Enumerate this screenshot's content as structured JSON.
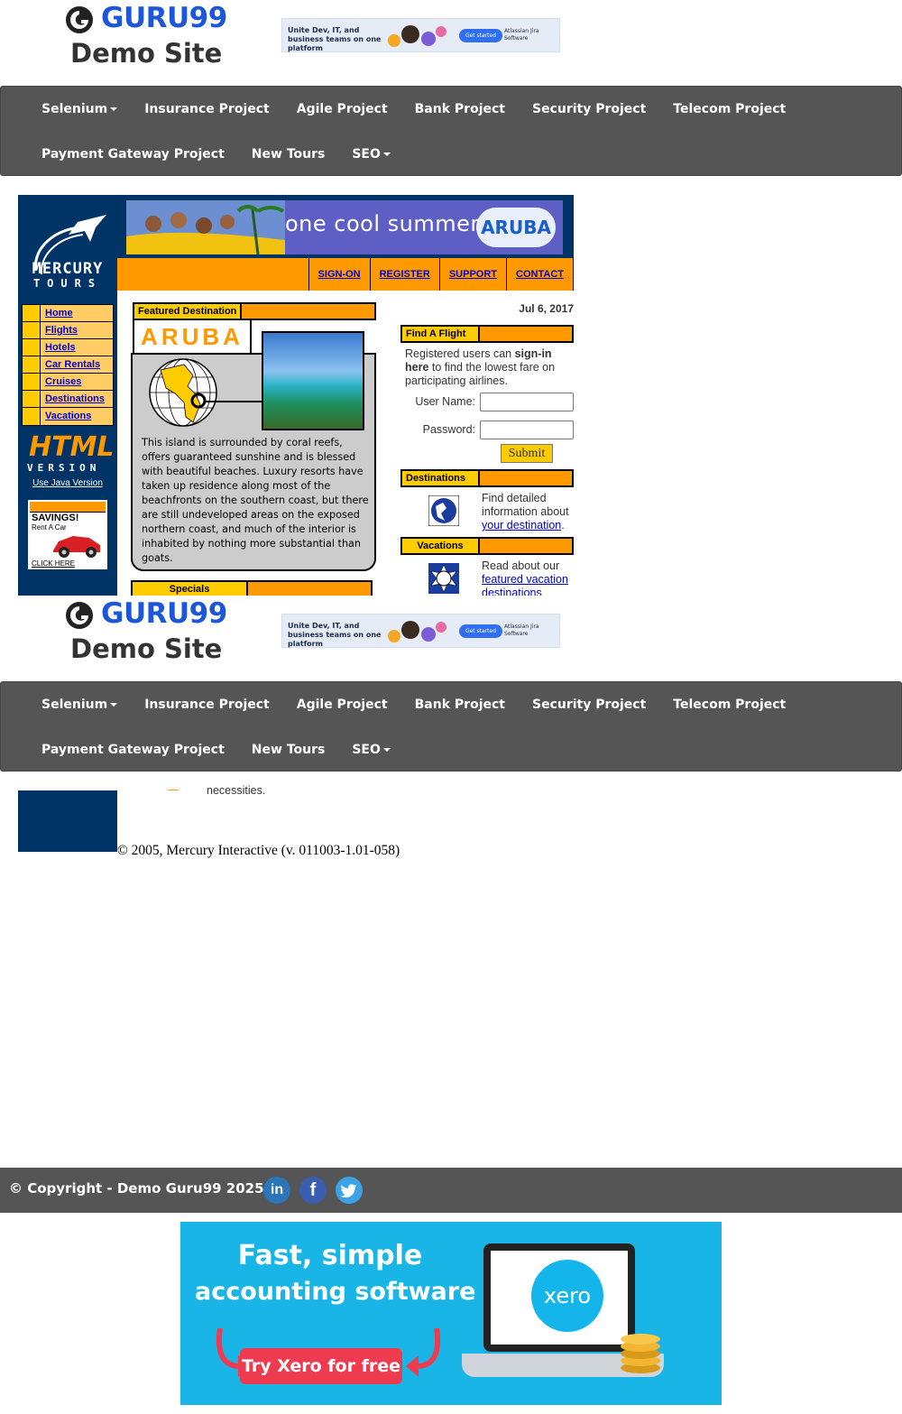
{
  "header": {
    "logo_brand": "GURU99",
    "logo_sub": "Demo Site",
    "ad_text": "Unite Dev, IT, and business teams on one platform",
    "ad_button": "Get started",
    "ad_brand": "Atlassian Jira Software"
  },
  "nav": {
    "row1": [
      {
        "label": "Selenium",
        "caret": true
      },
      {
        "label": "Insurance Project",
        "caret": false
      },
      {
        "label": "Agile Project",
        "caret": false
      },
      {
        "label": "Bank Project",
        "caret": false
      },
      {
        "label": "Security Project",
        "caret": false
      },
      {
        "label": "Telecom Project",
        "caret": false
      }
    ],
    "row2": [
      {
        "label": "Payment Gateway Project",
        "caret": false
      },
      {
        "label": "New Tours",
        "caret": false
      },
      {
        "label": "SEO",
        "caret": true
      }
    ]
  },
  "mercury": {
    "logo_line1": "MERCURY",
    "logo_line2": "TOURS",
    "banner_text": "one cool summer",
    "banner_badge": "ARUBA",
    "top_links": [
      "SIGN-ON",
      "REGISTER",
      "SUPPORT",
      "CONTACT"
    ],
    "menu": [
      "Home",
      "Flights",
      "Hotels",
      "Car Rentals",
      "Cruises",
      "Destinations",
      "Vacations"
    ],
    "html_word": "HTML",
    "html_version": "VERSION",
    "java_link": "Use Java Version",
    "savings_title": "SAVINGS!",
    "savings_sub": "Rent A Car",
    "savings_click": "CLICK HERE",
    "featured_label": "Featured Destination",
    "featured_title": "ARUBA",
    "featured_text": "This island is surrounded by coral reefs, offers guaranteed sunshine and is blessed with beautiful beaches. Luxury resorts have taken up residence along most of the beachfronts on the southern coast, but there are still undeveloped areas on the exposed northern coast, and much of the interior is inhabited by nothing more substantial than goats.",
    "specials_label": "Specials",
    "date": "Jul 6, 2017",
    "find_flight_label": "Find A Flight",
    "signin_pre": "Registered users can ",
    "signin_bold": "sign-in here",
    "signin_post": " to find the lowest fare on participating airlines.",
    "username_label": "User Name:",
    "password_label": "Password:",
    "username_value": "",
    "password_value": "",
    "submit_label": "Submit",
    "destinations_label": "Destinations",
    "destinations_pre": "Find detailed information about ",
    "destinations_link": "your destination",
    "destinations_post": ".",
    "vacations_label": "Vacations",
    "vacations_pre": "Read about our ",
    "vacations_link": "featured vacation destinations"
  },
  "lower": {
    "necessities": "necessities.",
    "copyright": "© 2005, Mercury Interactive (v. 011003-1.01-058)"
  },
  "footer": {
    "copyright": "© Copyright - Demo Guru99 2025",
    "social": [
      "in",
      "f",
      "t"
    ]
  },
  "bottom_ad": {
    "line1": "Fast, simple",
    "line2": "accounting software",
    "cta": "Try Xero for free",
    "logo": "xero"
  },
  "colors": {
    "guru_blue": "#1c57d9",
    "navbar": "#555555",
    "mercury_navy": "#003366",
    "mercury_orange": "#ff9900",
    "mercury_yellow": "#ffcc00"
  }
}
